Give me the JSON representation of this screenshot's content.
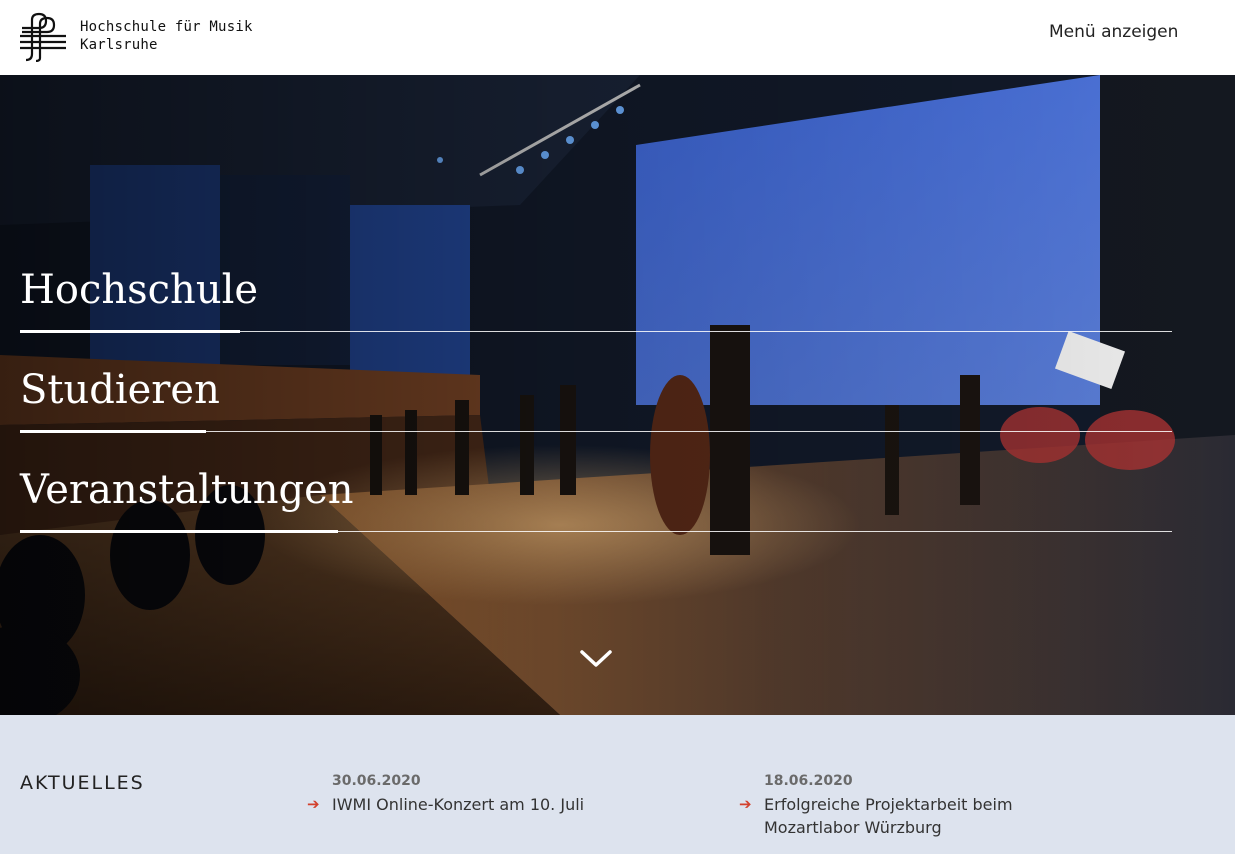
{
  "header": {
    "logo_line1": "Hochschule für Musik",
    "logo_line2": "Karlsruhe",
    "menu_label": "Menü anzeigen"
  },
  "hero": {
    "nav": [
      {
        "label": "Hochschule"
      },
      {
        "label": "Studieren"
      },
      {
        "label": "Veranstaltungen"
      }
    ],
    "scroll_icon": "chevron-down-icon"
  },
  "news": {
    "title": "AKTUELLES",
    "items": [
      {
        "date": "30.06.2020",
        "text": "IWMI Online-Konzert am 10. Juli"
      },
      {
        "date": "18.06.2020",
        "text": "Erfolgreiche Projektarbeit beim Mozartlabor Würzburg"
      }
    ]
  },
  "colors": {
    "accent": "#d3402c",
    "news_bg": "#dde3ee",
    "stage_blue": "#3a5fd0"
  }
}
